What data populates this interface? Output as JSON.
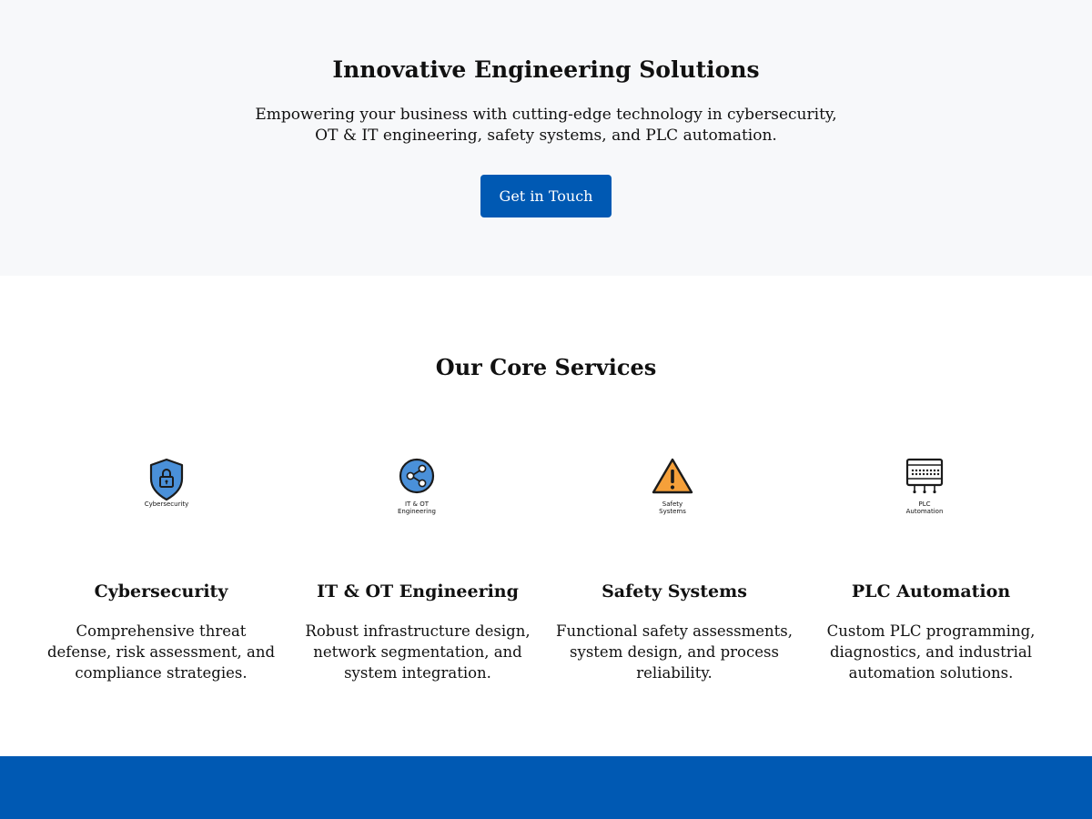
{
  "hero": {
    "title": "Innovative Engineering Solutions",
    "subtitle": "Empowering your business with cutting-edge technology in cybersecurity, OT & IT engineering, safety systems, and PLC automation.",
    "cta_label": "Get in Touch"
  },
  "services": {
    "title": "Our Core Services",
    "items": [
      {
        "icon": "shield-lock-icon",
        "icon_caption_1": "Cybersecurity",
        "icon_caption_2": "",
        "title": "Cybersecurity",
        "description": "Comprehensive threat defense, risk assessment, and compliance strategies."
      },
      {
        "icon": "network-share-icon",
        "icon_caption_1": "IT & OT",
        "icon_caption_2": "Engineering",
        "title": "IT & OT Engineering",
        "description": "Robust infrastructure design, network segmentation, and system integration."
      },
      {
        "icon": "warning-triangle-icon",
        "icon_caption_1": "Safety",
        "icon_caption_2": "Systems",
        "title": "Safety Systems",
        "description": "Functional safety assessments, system design, and process reliability."
      },
      {
        "icon": "plc-controller-icon",
        "icon_caption_1": "PLC",
        "icon_caption_2": "Automation",
        "title": "PLC Automation",
        "description": "Custom PLC programming, diagnostics, and industrial automation solutions."
      }
    ]
  },
  "colors": {
    "brand_blue": "#0059b3",
    "hero_bg": "#f7f8fa",
    "icon_blue": "#4a90d9",
    "warning_orange": "#f5a03a"
  }
}
